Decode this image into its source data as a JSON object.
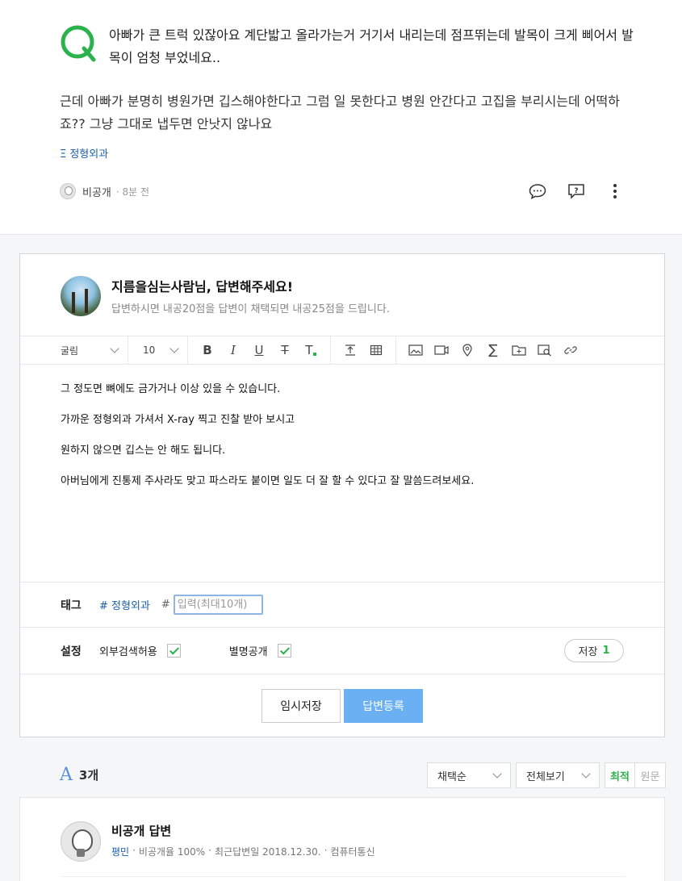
{
  "question": {
    "title": "아빠가 큰 트럭 있잖아요 계단밟고 올라가는거 거기서 내리는데 점프뛰는데 발목이 크게 삐어서 발목이 엄청 부었네요..",
    "body": "근데 아빠가 분명히 병원가면 깁스해야한다고 그럼 일 못한다고 병원 안간다고 고집을 부리시는데 어떡하죠?? 그냥 그대로 냅두면 안낫지 않나요",
    "tag": "Ξ 정형외과",
    "author": "비공개",
    "time": "8분 전",
    "icons": [
      "comment-icon",
      "report-icon",
      "more-icon"
    ]
  },
  "editor": {
    "title": "지름을심는사람님, 답변해주세요!",
    "subtitle": "답변하시면 내공20점을 답변이 채택되면 내공25점을 드립니다.",
    "toolbar": {
      "font": "굴림",
      "size": "10"
    },
    "body": [
      "그 정도면 뼈에도 금가거나 이상 있을 수 있습니다.",
      "가까운 정형외과 가셔서 X-ray 찍고 진찰 받아 보시고",
      "원하지 않으면 깁스는 안 해도 됩니다.",
      "아버님에게 진통제 주사라도 맞고 파스라도 붙이면 일도 더 잘 할 수 있다고 잘 말씀드려보세요."
    ],
    "tags": {
      "label": "태그",
      "chip": "# 정형외과",
      "hash": "#",
      "placeholder": "입력(최대10개)"
    },
    "settings": {
      "label": "설정",
      "external_search": "외부검색허용",
      "anonymous": "별명공개",
      "save_label": "저장",
      "save_count": "1"
    },
    "temp_save": "임시저장",
    "submit": "답변등록"
  },
  "answers": {
    "icon_letter": "A",
    "count": "3개",
    "sort": "채택순",
    "filter": "전체보기",
    "seg_best": "최적",
    "seg_orig": "원문",
    "first": {
      "name": "비공개 답변",
      "grade": "평민",
      "private_rate": "비공개율 100%",
      "recent": "최근답변일 2018.12.30.",
      "category": "컴퓨터통신"
    }
  },
  "colors": {
    "accent_green": "#2bb24c",
    "link_blue": "#1a5faa",
    "submit_blue": "#6ab0f3"
  }
}
